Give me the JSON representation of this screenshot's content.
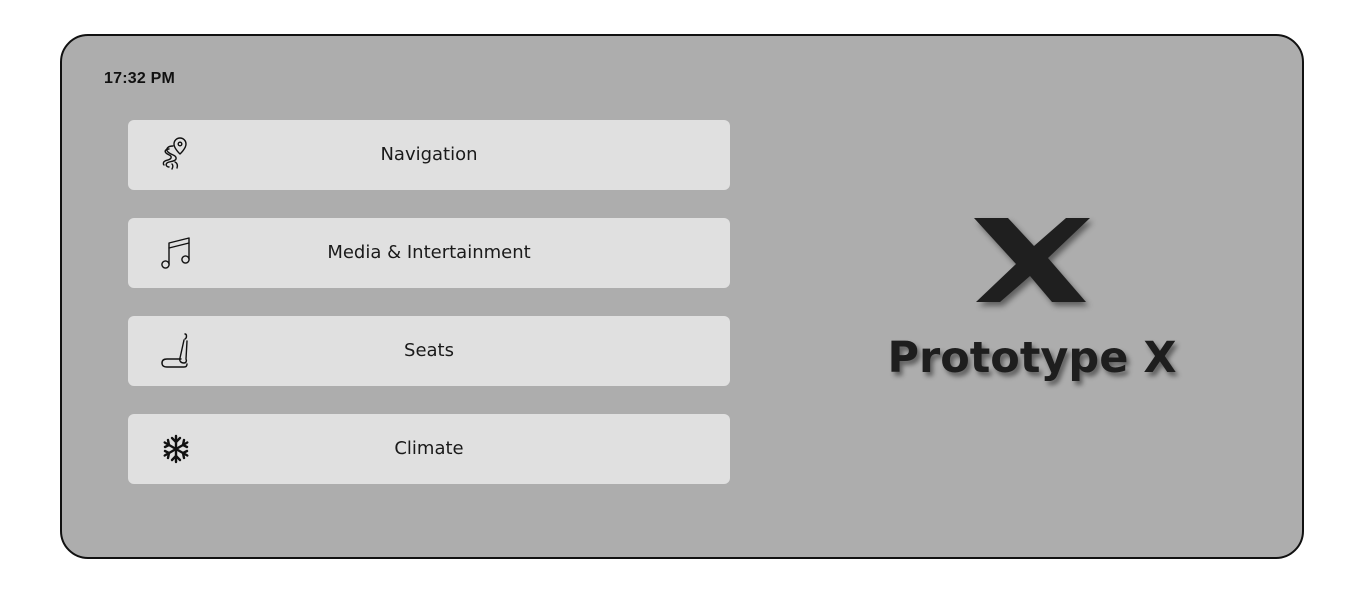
{
  "status": {
    "time": "17:32 PM"
  },
  "menu": {
    "items": [
      {
        "label": "Navigation",
        "icon": "route-pin-icon"
      },
      {
        "label": "Media & Intertainment",
        "icon": "music-notes-icon"
      },
      {
        "label": "Seats",
        "icon": "car-seat-icon"
      },
      {
        "label": "Climate",
        "icon": "snowflake-icon"
      }
    ]
  },
  "brand": {
    "logo_icon": "x-logo-icon",
    "name": "Prototype X"
  },
  "colors": {
    "screen_background": "#adadad",
    "button_background": "#e0e0e0",
    "text": "#1a1a1a"
  }
}
